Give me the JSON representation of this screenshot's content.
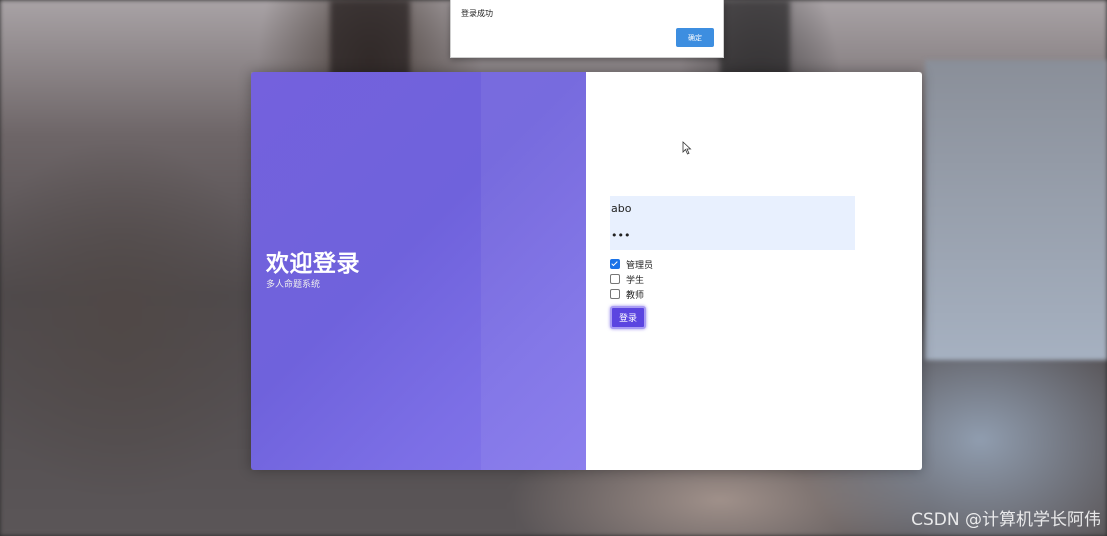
{
  "alert": {
    "message": "登录成功",
    "ok_label": "确定"
  },
  "welcome": {
    "title": "欢迎登录",
    "subtitle": "多人命题系统"
  },
  "login_form": {
    "username_value": "abo",
    "password_value": "***",
    "roles": [
      {
        "label": "管理员",
        "checked": true
      },
      {
        "label": "学生",
        "checked": false
      },
      {
        "label": "教师",
        "checked": false
      }
    ],
    "submit_label": "登录"
  },
  "watermark": "CSDN @计算机学长阿伟",
  "colors": {
    "accent": "#6f62dc",
    "button": "#5b45e0",
    "dialog_ok": "#3d8ee0",
    "field_bg": "#e8f0fe"
  }
}
